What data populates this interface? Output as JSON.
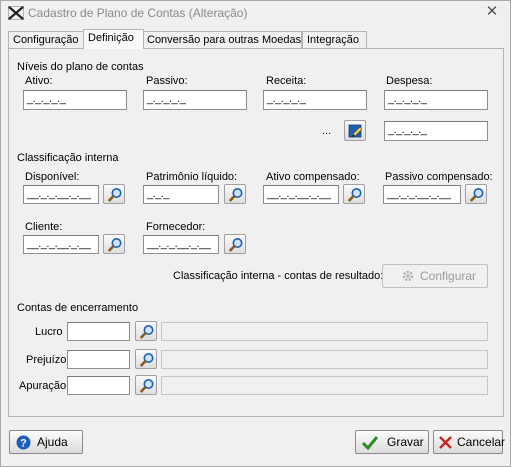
{
  "window": {
    "title": "Cadastro de Plano de Contas (Alteração)"
  },
  "tabs": [
    {
      "label": "Configuração"
    },
    {
      "label": "Definição"
    },
    {
      "label": "Conversão para outras Moedas"
    },
    {
      "label": "Integração"
    }
  ],
  "niveis": {
    "heading": "Níveis do plano de contas",
    "ativo": {
      "label": "Ativo:",
      "value": "_._._._._"
    },
    "passivo": {
      "label": "Passivo:",
      "value": "_._._._._"
    },
    "receita": {
      "label": "Receita:",
      "value": "_._._._._"
    },
    "despesa": {
      "label": "Despesa:",
      "value": "_._._._._"
    },
    "ellipsis": "...",
    "extra": {
      "value": "_._._._._"
    }
  },
  "classificacao": {
    "heading": "Classificação interna",
    "disponivel": {
      "label": "Disponível:",
      "value": "__._._.__._.__"
    },
    "patrimonio": {
      "label": "Patrimônio líquido:",
      "value": "_._._"
    },
    "ativo_comp": {
      "label": "Ativo compensado:",
      "value": "__._._.__._.__"
    },
    "passivo_comp": {
      "label": "Passivo compensado:",
      "value": "__._._.__._.__"
    },
    "cliente": {
      "label": "Cliente:",
      "value": "__._._.__._.__"
    },
    "fornecedor": {
      "label": "Fornecedor:",
      "value": "__._._.__._.__"
    },
    "resultado_label": "Classificação interna - contas de resultado:",
    "configurar": "Configurar"
  },
  "encerramento": {
    "heading": "Contas de encerramento",
    "lucro": {
      "label": "Lucro",
      "value": ""
    },
    "prejuizo": {
      "label": "Prejuízo",
      "value": ""
    },
    "apuracao": {
      "label": "Apuração",
      "value": ""
    }
  },
  "footer": {
    "ajuda": "Ajuda",
    "gravar": "Gravar",
    "cancelar": "Cancelar"
  },
  "colors": {
    "accent_blue": "#1e5fb4",
    "gravar_green": "#2e8b22",
    "cancel_red": "#c8231e"
  }
}
